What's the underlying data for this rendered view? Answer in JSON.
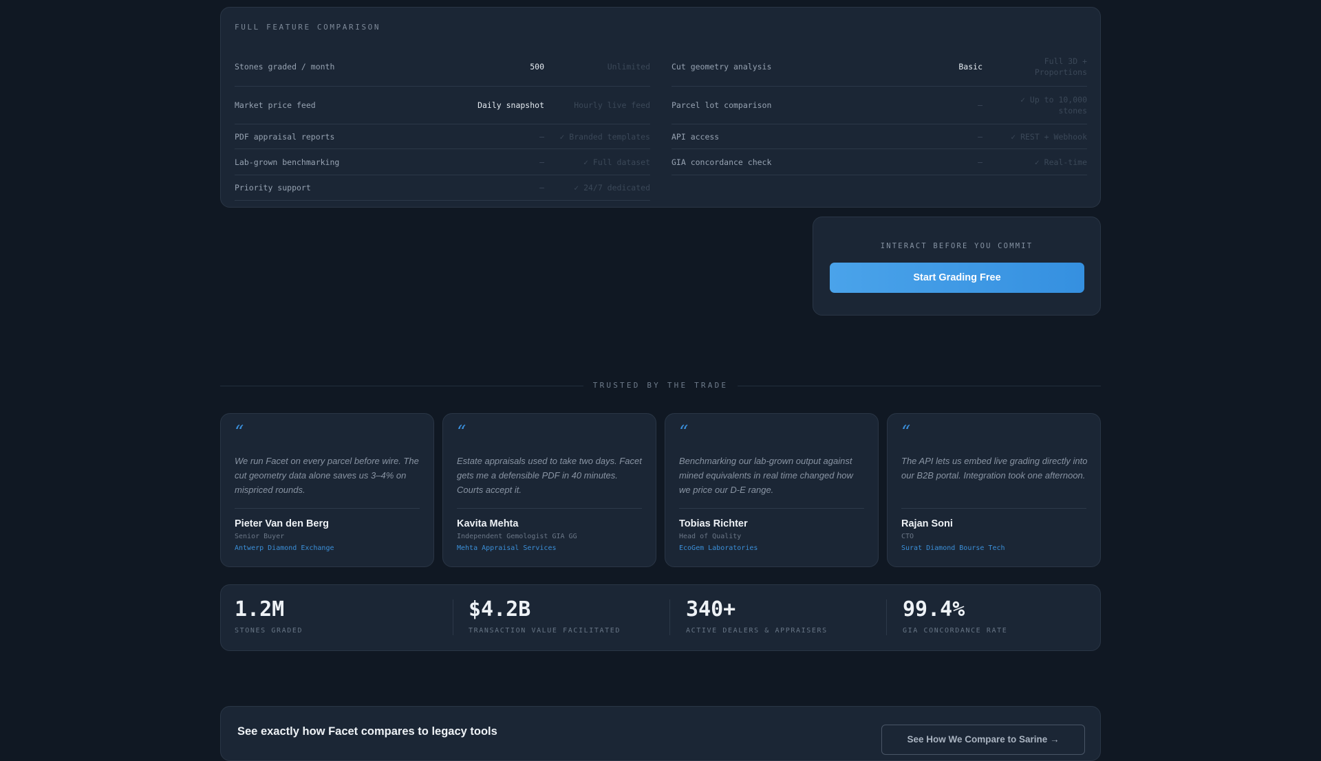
{
  "features": {
    "section_title": "FULL FEATURE COMPARISON",
    "left": [
      {
        "name": "Stones graded / month",
        "basic": "500",
        "pro": "Unlimited"
      },
      {
        "name": "Market price feed",
        "basic": "Daily snapshot",
        "pro": "Hourly live feed"
      },
      {
        "name": "PDF appraisal reports",
        "basic": "—",
        "pro": "✓ Branded templates"
      },
      {
        "name": "Lab-grown benchmarking",
        "basic": "—",
        "pro": "✓ Full dataset"
      },
      {
        "name": "Priority support",
        "basic": "—",
        "pro": "✓ 24/7 dedicated"
      }
    ],
    "right": [
      {
        "name": "Cut geometry analysis",
        "basic": "Basic",
        "pro": "Full 3D + Proportions"
      },
      {
        "name": "Parcel lot comparison",
        "basic": "—",
        "pro": "✓ Up to 10,000 stones"
      },
      {
        "name": "API access",
        "basic": "—",
        "pro": "✓ REST + Webhook"
      },
      {
        "name": "GIA concordance check",
        "basic": "—",
        "pro": "✓ Real-time"
      }
    ]
  },
  "cta": {
    "eyebrow": "INTERACT BEFORE YOU COMMIT",
    "button_label": "Start Grading Free",
    "accent": "#3d97e4"
  },
  "trusted": {
    "label": "TRUSTED BY THE TRADE"
  },
  "testimonials": [
    {
      "quote": "We run Facet on every parcel before wire. The cut geometry data alone saves us 3–4% on mispriced rounds.",
      "name": "Pieter Van den Berg",
      "role": "Senior Buyer",
      "company": "Antwerp Diamond Exchange"
    },
    {
      "quote": "Estate appraisals used to take two days. Facet gets me a defensible PDF in 40 minutes. Courts accept it.",
      "name": "Kavita Mehta",
      "role": "Independent Gemologist GIA GG",
      "company": "Mehta Appraisal Services"
    },
    {
      "quote": "Benchmarking our lab-grown output against mined equivalents in real time changed how we price our D-E range.",
      "name": "Tobias Richter",
      "role": "Head of Quality",
      "company": "EcoGem Laboratories"
    },
    {
      "quote": "The API lets us embed live grading directly into our B2B portal. Integration took one afternoon.",
      "name": "Rajan Soni",
      "role": "CTO",
      "company": "Surat Diamond Bourse Tech"
    }
  ],
  "stats": [
    {
      "value": "1.2M",
      "label": "STONES GRADED"
    },
    {
      "value": "$4.2B",
      "label": "TRANSACTION VALUE FACILITATED"
    },
    {
      "value": "340+",
      "label": "ACTIVE DEALERS & APPRAISERS"
    },
    {
      "value": "99.4%",
      "label": "GIA CONCORDANCE RATE"
    }
  ],
  "compare": {
    "heading": "See exactly how Facet compares to legacy tools",
    "button_label": "See How We Compare to Sarine →"
  }
}
